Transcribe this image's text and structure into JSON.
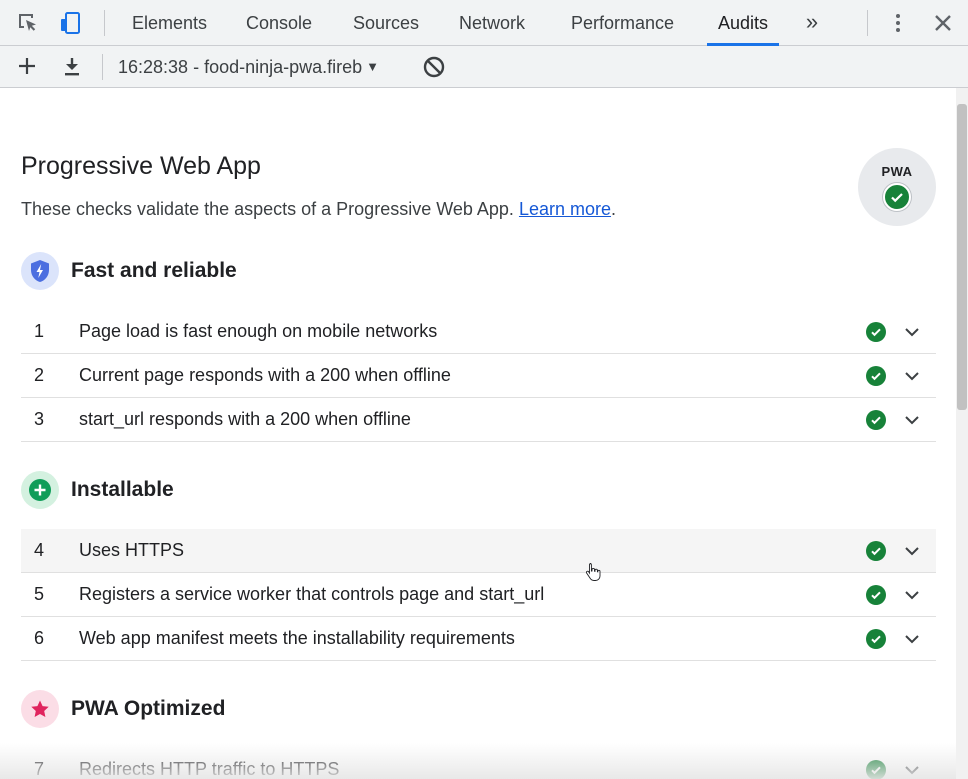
{
  "devtools": {
    "tabs": [
      {
        "label": "Elements"
      },
      {
        "label": "Console"
      },
      {
        "label": "Sources"
      },
      {
        "label": "Network"
      },
      {
        "label": "Performance"
      },
      {
        "label": "Audits",
        "active": true
      }
    ],
    "more_tabs_label": "»"
  },
  "toolbar": {
    "report_label": "16:28:38 - food-ninja-pwa.fireb"
  },
  "category": {
    "title": "Progressive Web App",
    "description": "These checks validate the aspects of a Progressive Web App.",
    "learn_more": "Learn more",
    "description_end": ".",
    "badge_text": "PWA"
  },
  "groups": [
    {
      "title": "Fast and reliable",
      "icon": "shield-bolt-icon",
      "color": "#4c6fe0",
      "audits": [
        {
          "num": "1",
          "title": "Page load is fast enough on mobile networks"
        },
        {
          "num": "2",
          "title": "Current page responds with a 200 when offline"
        },
        {
          "num": "3",
          "title": "start_url responds with a 200 when offline"
        }
      ]
    },
    {
      "title": "Installable",
      "icon": "plus-circle-icon",
      "color": "#0f9d58",
      "audits": [
        {
          "num": "4",
          "title": "Uses HTTPS"
        },
        {
          "num": "5",
          "title": "Registers a service worker that controls page and start_url"
        },
        {
          "num": "6",
          "title": "Web app manifest meets the installability requirements"
        }
      ]
    },
    {
      "title": "PWA Optimized",
      "icon": "star-icon",
      "color": "#e0245e",
      "audits": [
        {
          "num": "7",
          "title": "Redirects HTTP traffic to HTTPS"
        }
      ]
    }
  ],
  "colors": {
    "pass": "#178239",
    "accent": "#1a73e8"
  }
}
